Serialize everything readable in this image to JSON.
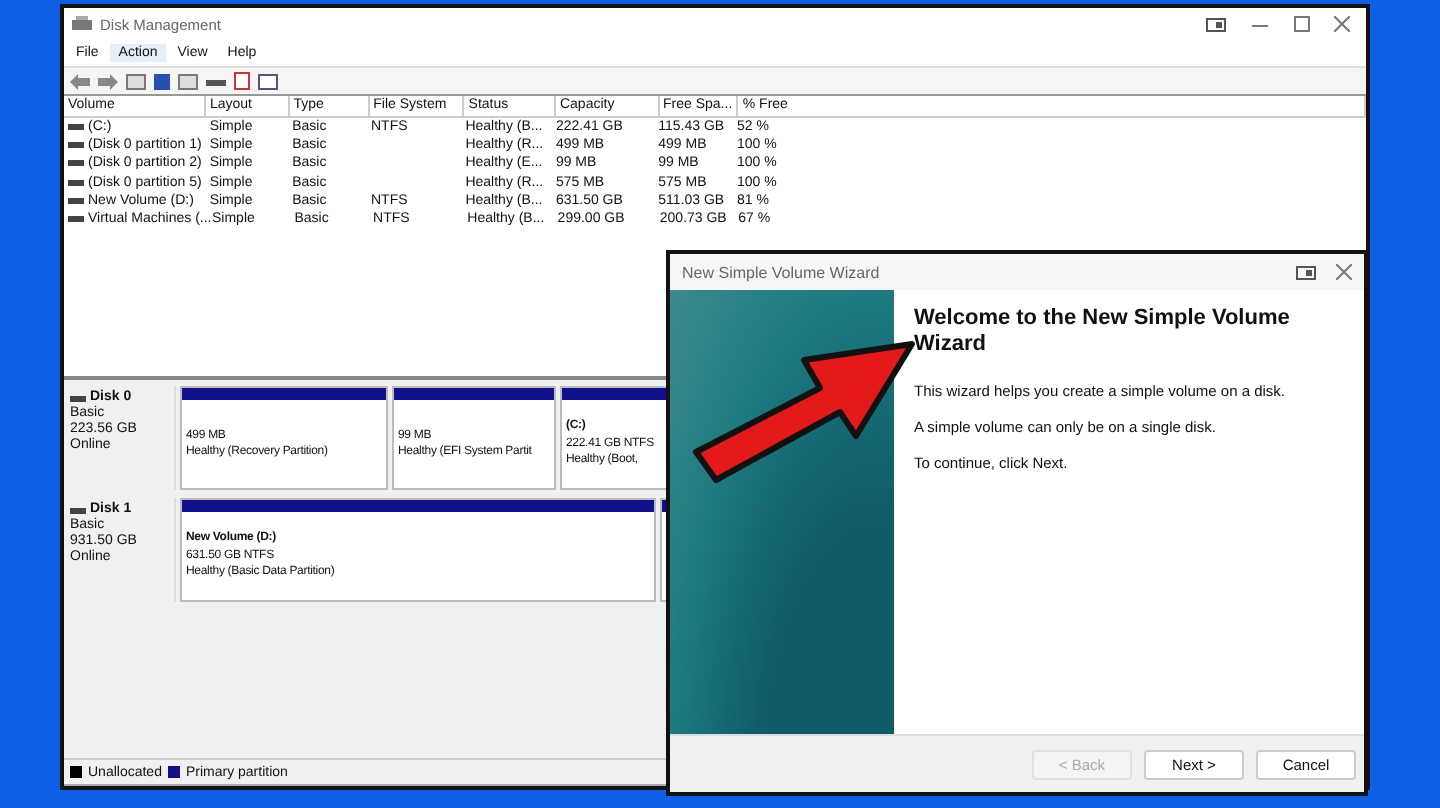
{
  "window": {
    "title": "Disk Management"
  },
  "menu": [
    {
      "label": "File",
      "selected": false
    },
    {
      "label": "Action",
      "selected": true
    },
    {
      "label": "View",
      "selected": false
    },
    {
      "label": "Help",
      "selected": false
    }
  ],
  "table": {
    "columns": [
      "Volume",
      "Layout",
      "Type",
      "File System",
      "Status",
      "Capacity",
      "Free Spa...",
      "% Free"
    ],
    "rows": [
      [
        "(C:)",
        "Simple",
        "Basic",
        "NTFS",
        "Healthy (B...",
        "222.41 GB",
        "115.43 GB",
        "52 %"
      ],
      [
        "(Disk 0 partition 1)",
        "Simple",
        "Basic",
        "",
        "Healthy (R...",
        "499 MB",
        "499 MB",
        "100 %"
      ],
      [
        "(Disk 0 partition 2)",
        "Simple",
        "Basic",
        "",
        "Healthy (E...",
        "99 MB",
        "99 MB",
        "100 %"
      ],
      [
        "(Disk 0 partition 5)",
        "Simple",
        "Basic",
        "",
        "Healthy (R...",
        "575 MB",
        "575 MB",
        "100 %"
      ],
      [
        "New Volume (D:)",
        "Simple",
        "Basic",
        "NTFS",
        "Healthy (B...",
        "631.50 GB",
        "511.03 GB",
        "81 %"
      ],
      [
        "Virtual Machines (...",
        "Simple",
        "Basic",
        "NTFS",
        "Healthy (B...",
        "299.00 GB",
        "200.73 GB",
        "67 %"
      ]
    ]
  },
  "disks": [
    {
      "name": "Disk 0",
      "type": "Basic",
      "size": "223.56 GB",
      "state": "Online",
      "partitions": [
        {
          "lines": [
            "499 MB",
            "Healthy (Recovery Partition)"
          ]
        },
        {
          "lines": [
            "99 MB",
            "Healthy (EFI System Partit"
          ]
        },
        {
          "title": "(C:)",
          "lines": [
            "222.41 GB NTFS",
            "Healthy (Boot,"
          ]
        }
      ]
    },
    {
      "name": "Disk 1",
      "type": "Basic",
      "size": "931.50 GB",
      "state": "Online",
      "partitions": [
        {
          "title": "New Volume  (D:)",
          "lines": [
            "631.50 GB NTFS",
            "Healthy (Basic Data Partition)"
          ]
        }
      ]
    }
  ],
  "legend": [
    {
      "label": "Unallocated",
      "color": "#000000"
    },
    {
      "label": "Primary partition",
      "color": "#10108a"
    }
  ],
  "wizard": {
    "title": "New Simple Volume Wizard",
    "heading": "Welcome to the New Simple Volume Wizard",
    "paragraphs": [
      "This wizard helps you create a simple volume on a disk.",
      "A simple volume can only be on a single disk.",
      "To continue, click Next."
    ],
    "buttons": [
      {
        "label": "< Back",
        "disabled": true
      },
      {
        "label": "Next >",
        "disabled": false
      },
      {
        "label": "Cancel",
        "disabled": false
      }
    ]
  }
}
